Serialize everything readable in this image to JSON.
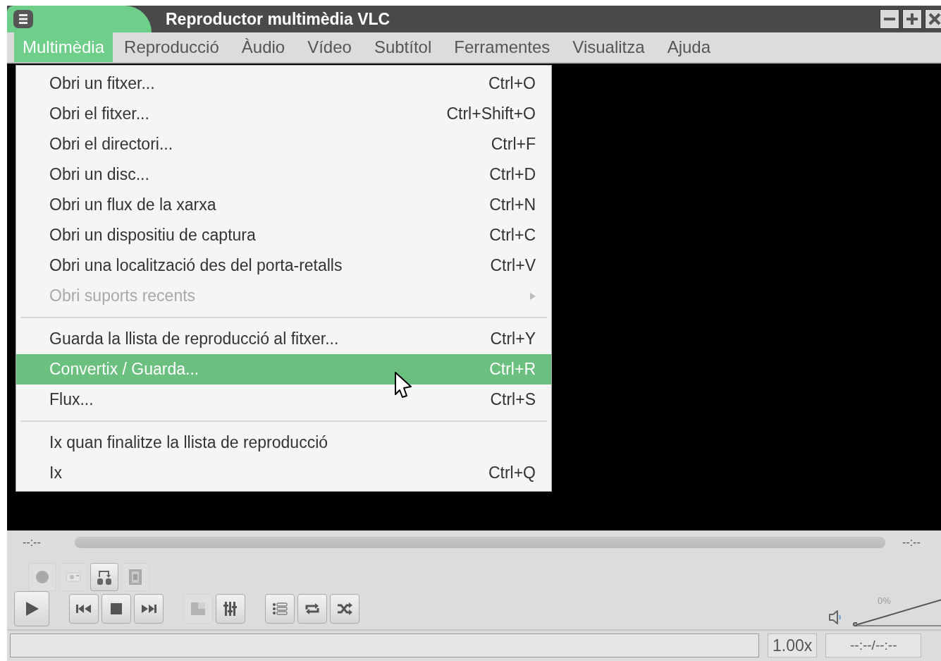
{
  "window": {
    "title": "Reproductor multimèdia VLC"
  },
  "menubar": [
    {
      "label": "Multimèdia",
      "selected": true
    },
    {
      "label": "Reproducció",
      "selected": false
    },
    {
      "label": "Àudio",
      "selected": false
    },
    {
      "label": "Vídeo",
      "selected": false
    },
    {
      "label": "Subtítol",
      "selected": false
    },
    {
      "label": "Ferramentes",
      "selected": false
    },
    {
      "label": "Visualitza",
      "selected": false
    },
    {
      "label": "Ajuda",
      "selected": false
    }
  ],
  "menu": [
    {
      "kind": "item",
      "label": "Obri un fitxer...",
      "shortcut": "Ctrl+O",
      "disabled": false,
      "selected": false
    },
    {
      "kind": "item",
      "label": "Obri el fitxer...",
      "shortcut": "Ctrl+Shift+O",
      "disabled": false,
      "selected": false
    },
    {
      "kind": "item",
      "label": "Obri el directori...",
      "shortcut": "Ctrl+F",
      "disabled": false,
      "selected": false
    },
    {
      "kind": "item",
      "label": "Obri un disc...",
      "shortcut": "Ctrl+D",
      "disabled": false,
      "selected": false
    },
    {
      "kind": "item",
      "label": "Obri un flux de la xarxa",
      "shortcut": "Ctrl+N",
      "disabled": false,
      "selected": false
    },
    {
      "kind": "item",
      "label": "Obri un dispositiu de captura",
      "shortcut": "Ctrl+C",
      "disabled": false,
      "selected": false
    },
    {
      "kind": "item",
      "label": "Obri una localització des del porta-retalls",
      "shortcut": "Ctrl+V",
      "disabled": false,
      "selected": false
    },
    {
      "kind": "submenu",
      "label": "Obri suports recents",
      "disabled": true,
      "selected": false
    },
    {
      "kind": "separator"
    },
    {
      "kind": "item",
      "label": "Guarda la llista de reproducció al fitxer...",
      "shortcut": "Ctrl+Y",
      "disabled": false,
      "selected": false
    },
    {
      "kind": "item",
      "label": "Convertix / Guarda...",
      "shortcut": "Ctrl+R",
      "disabled": false,
      "selected": true
    },
    {
      "kind": "item",
      "label": "Flux...",
      "shortcut": "Ctrl+S",
      "disabled": false,
      "selected": false
    },
    {
      "kind": "separator"
    },
    {
      "kind": "item",
      "label": "Ix quan finalitze la llista de reproducció",
      "disabled": false,
      "selected": false
    },
    {
      "kind": "item",
      "label": "Ix",
      "shortcut": "Ctrl+Q",
      "disabled": false,
      "selected": false
    }
  ],
  "seek": {
    "elapsed": "--:--",
    "remaining": "--:--"
  },
  "advanced_controls": [
    {
      "kind": "record",
      "disabled": true
    },
    {
      "kind": "snapshot",
      "disabled": true
    },
    {
      "kind": "ab-loop",
      "disabled": false
    },
    {
      "kind": "frame",
      "disabled": true
    }
  ],
  "controls": [
    {
      "kind": "play",
      "disabled": false
    },
    {
      "kind": "gap"
    },
    {
      "kind": "previous",
      "disabled": false
    },
    {
      "kind": "stop",
      "disabled": false
    },
    {
      "kind": "next",
      "disabled": false
    },
    {
      "kind": "gap"
    },
    {
      "kind": "fullscreen",
      "disabled": true
    },
    {
      "kind": "equalizer",
      "disabled": false
    },
    {
      "kind": "gap"
    },
    {
      "kind": "playlist",
      "disabled": false
    },
    {
      "kind": "loop",
      "disabled": false
    },
    {
      "kind": "shuffle",
      "disabled": false
    }
  ],
  "volume": {
    "reading": "0%",
    "level": 0
  },
  "status_bar": {
    "speed": "1.00x",
    "time": "--:--/--:--"
  }
}
